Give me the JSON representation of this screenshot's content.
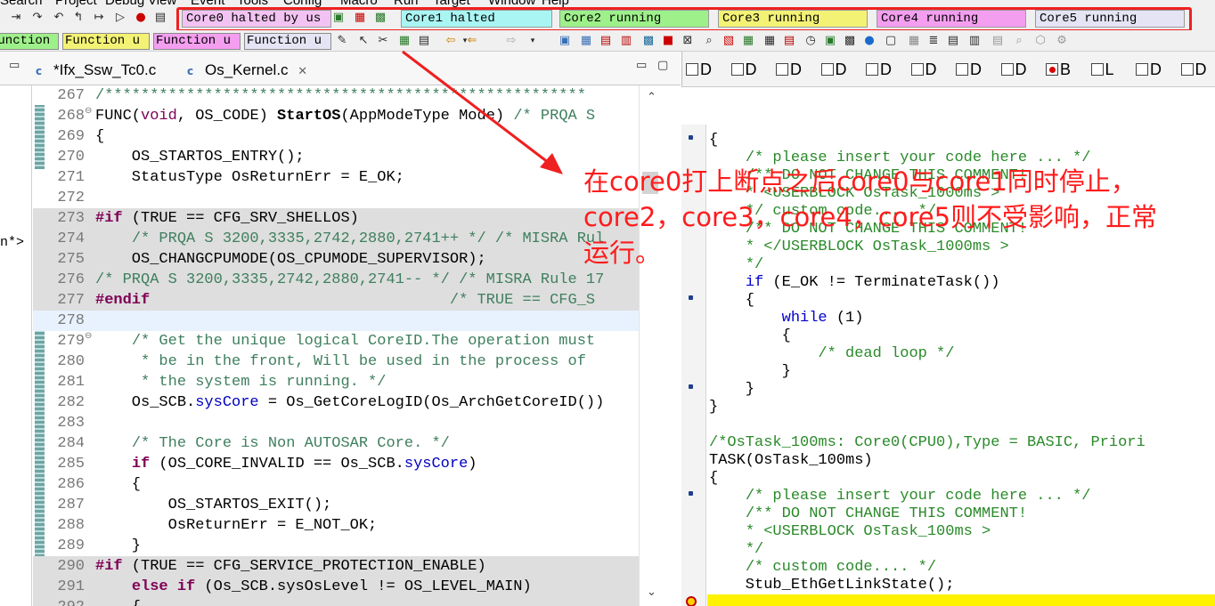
{
  "menu": {
    "items": [
      "Search",
      "Project",
      "Debug",
      "View",
      "Event",
      "Tools",
      "Config",
      "Macro",
      "Run",
      "Target",
      "Window",
      "Help"
    ]
  },
  "core_status": [
    {
      "label": "Core0 halted by us",
      "color": "#f2c3f2"
    },
    {
      "label": "Core1 halted",
      "color": "#a9f5f3"
    },
    {
      "label": "Core2 running",
      "color": "#9ef08a"
    },
    {
      "label": "Core3 running",
      "color": "#f4f275"
    },
    {
      "label": "Core4 running",
      "color": "#f49ef0"
    },
    {
      "label": "Core5 running",
      "color": "#e4e4f4"
    }
  ],
  "function_boxes": [
    {
      "label": "Function u",
      "color": "#9ef08a"
    },
    {
      "label": "Function u",
      "color": "#f4f275"
    },
    {
      "label": "Function u",
      "color": "#f49ef0"
    },
    {
      "label": "Function u",
      "color": "#e4e4f4"
    }
  ],
  "editor_tabs": [
    {
      "label": "*Ifx_Ssw_Tc0.c"
    },
    {
      "label": "Os_Kernel.c",
      "close": "✕"
    }
  ],
  "outline": {
    "text": "n*>"
  },
  "code_lines": [
    {
      "n": "267",
      "style": "",
      "fold": "",
      "html": "<span class='cm'>/*****************************************************</span>"
    },
    {
      "n": "268",
      "style": "",
      "fold": "⊖",
      "html": "FUNC(<span class='kwn'>void</span>, OS_CODE) <b>StartOS</b>(AppModeType Mode) <span class='cm'>/* PRQA S</span>"
    },
    {
      "n": "269",
      "style": "",
      "fold": "",
      "html": "{"
    },
    {
      "n": "270",
      "style": "",
      "fold": "",
      "html": "    OS_STARTOS_ENTRY();"
    },
    {
      "n": "271",
      "style": "",
      "fold": "",
      "html": "    StatusType OsReturnErr = E_OK;"
    },
    {
      "n": "272",
      "style": "",
      "fold": "",
      "html": ""
    },
    {
      "n": "273",
      "style": "gray",
      "fold": "",
      "html": "<span class='pp'>#if</span> (TRUE == CFG_SRV_SHELLOS)"
    },
    {
      "n": "274",
      "style": "gray",
      "fold": "",
      "html": "    <span class='cm'>/* PRQA S 3200,3335,2742,2880,2741++ */ /* MISRA Rul</span>"
    },
    {
      "n": "275",
      "style": "gray",
      "fold": "",
      "html": "    OS_CHANGCPUMODE(OS_CPUMODE_SUPERVISOR);"
    },
    {
      "n": "276",
      "style": "gray",
      "fold": "",
      "html": "<span class='cm'>/* PRQA S 3200,3335,2742,2880,2741-- */ /* MISRA Rule 17</span>"
    },
    {
      "n": "277",
      "style": "gray",
      "fold": "",
      "html": "<span class='pp'>#endif</span>                                 <span class='cm'>/* TRUE == CFG_S</span>"
    },
    {
      "n": "278",
      "style": "cur",
      "fold": "",
      "html": ""
    },
    {
      "n": "279",
      "style": "",
      "fold": "⊖",
      "html": "    <span class='cm'>/* Get the unique logical CoreID.The operation must</span>"
    },
    {
      "n": "280",
      "style": "",
      "fold": "",
      "html": "<span class='cm'>     * be in the front, Will be used in the process of</span>"
    },
    {
      "n": "281",
      "style": "",
      "fold": "",
      "html": "<span class='cm'>     * the system is running. */</span>"
    },
    {
      "n": "282",
      "style": "",
      "fold": "",
      "html": "    Os_SCB.<span class='fld'>sysCore</span> = Os_GetCoreLogID(Os_ArchGetCoreID())"
    },
    {
      "n": "283",
      "style": "",
      "fold": "",
      "html": ""
    },
    {
      "n": "284",
      "style": "",
      "fold": "",
      "html": "    <span class='cm'>/* The Core is Non AUTOSAR Core. */</span>"
    },
    {
      "n": "285",
      "style": "",
      "fold": "",
      "html": "    <span class='kw'>if</span> (OS_CORE_INVALID == Os_SCB.<span class='fld'>sysCore</span>)"
    },
    {
      "n": "286",
      "style": "",
      "fold": "",
      "html": "    {"
    },
    {
      "n": "287",
      "style": "",
      "fold": "",
      "html": "        OS_STARTOS_EXIT();"
    },
    {
      "n": "288",
      "style": "",
      "fold": "",
      "html": "        OsReturnErr = E_NOT_OK;"
    },
    {
      "n": "289",
      "style": "",
      "fold": "",
      "html": "    }"
    },
    {
      "n": "290",
      "style": "gray",
      "fold": "",
      "html": "<span class='pp'>#if</span> (TRUE == CFG_SERVICE_PROTECTION_ENABLE)"
    },
    {
      "n": "291",
      "style": "gray",
      "fold": "",
      "html": "    <span class='kw'>else if</span> (Os_SCB.sysOsLevel != OS_LEVEL_MAIN)"
    },
    {
      "n": "292",
      "style": "gray",
      "fold": "",
      "html": "    {"
    }
  ],
  "right_tabs": [
    {
      "label": "D",
      "icon": "plain"
    },
    {
      "label": "D",
      "icon": "plain"
    },
    {
      "label": "D",
      "icon": "plain"
    },
    {
      "label": "D",
      "icon": "plain"
    },
    {
      "label": "D",
      "icon": "plain"
    },
    {
      "label": "D",
      "icon": "plain"
    },
    {
      "label": "D",
      "icon": "plain"
    },
    {
      "label": "D",
      "icon": "plain"
    },
    {
      "label": "B",
      "icon": "red"
    },
    {
      "label": "L",
      "icon": "plain"
    },
    {
      "label": "D",
      "icon": "plain"
    },
    {
      "label": "D",
      "icon": "plain"
    }
  ],
  "right_code": [
    "{",
    "    <span class='g'>/* please insert your code here ... */</span>",
    "    <span class='g'>/** DO NOT CHANGE THIS COMMENT!</span>",
    "    <span class='g'>* &lt;USERBLOCK OsTask_1000ms &gt;</span>",
    "    <span class='g'>*/ custom code.... */</span>",
    "    <span class='g'>/** DO NOT CHANGE THIS COMMENT!</span>",
    "    <span class='g'>* &lt;/USERBLOCK OsTask_1000ms &gt;</span>",
    "    <span class='g'>*/</span>",
    "    <span class='b'>if</span> (E_OK != TerminateTask())",
    "    {",
    "        <span class='b'>while</span> (1)",
    "        {",
    "            <span class='g'>/* dead loop */</span>",
    "        }",
    "    }",
    "}",
    "",
    "<span class='g'>/*OsTask_100ms: Core0(CPU0),Type = BASIC, Priori</span>",
    "TASK(OsTask_100ms)",
    "{",
    "    <span class='g'>/* please insert your code here ... */</span>",
    "    <span class='g'>/** DO NOT CHANGE THIS COMMENT!</span>",
    "    <span class='g'>* &lt;USERBLOCK OsTask_100ms &gt;</span>",
    "    <span class='g'>*/</span>",
    "    <span class='g'>/* custom code.... */</span>",
    "    Stub_EthGetLinkState();"
  ],
  "annotation": {
    "line1": "在core0打上断点之后core0与core1同时停止，",
    "line2": "core2，core3，core4，core5则不受影响，正常",
    "line3": "运行。",
    "color": "#ff1b1b"
  },
  "colors": {
    "highlight_border": "#ee2020",
    "arrow": "#ee2020",
    "current_line": "#e8f2fe",
    "inactive_code_bg": "#dedede",
    "breakpoint_line": "#fff200"
  }
}
